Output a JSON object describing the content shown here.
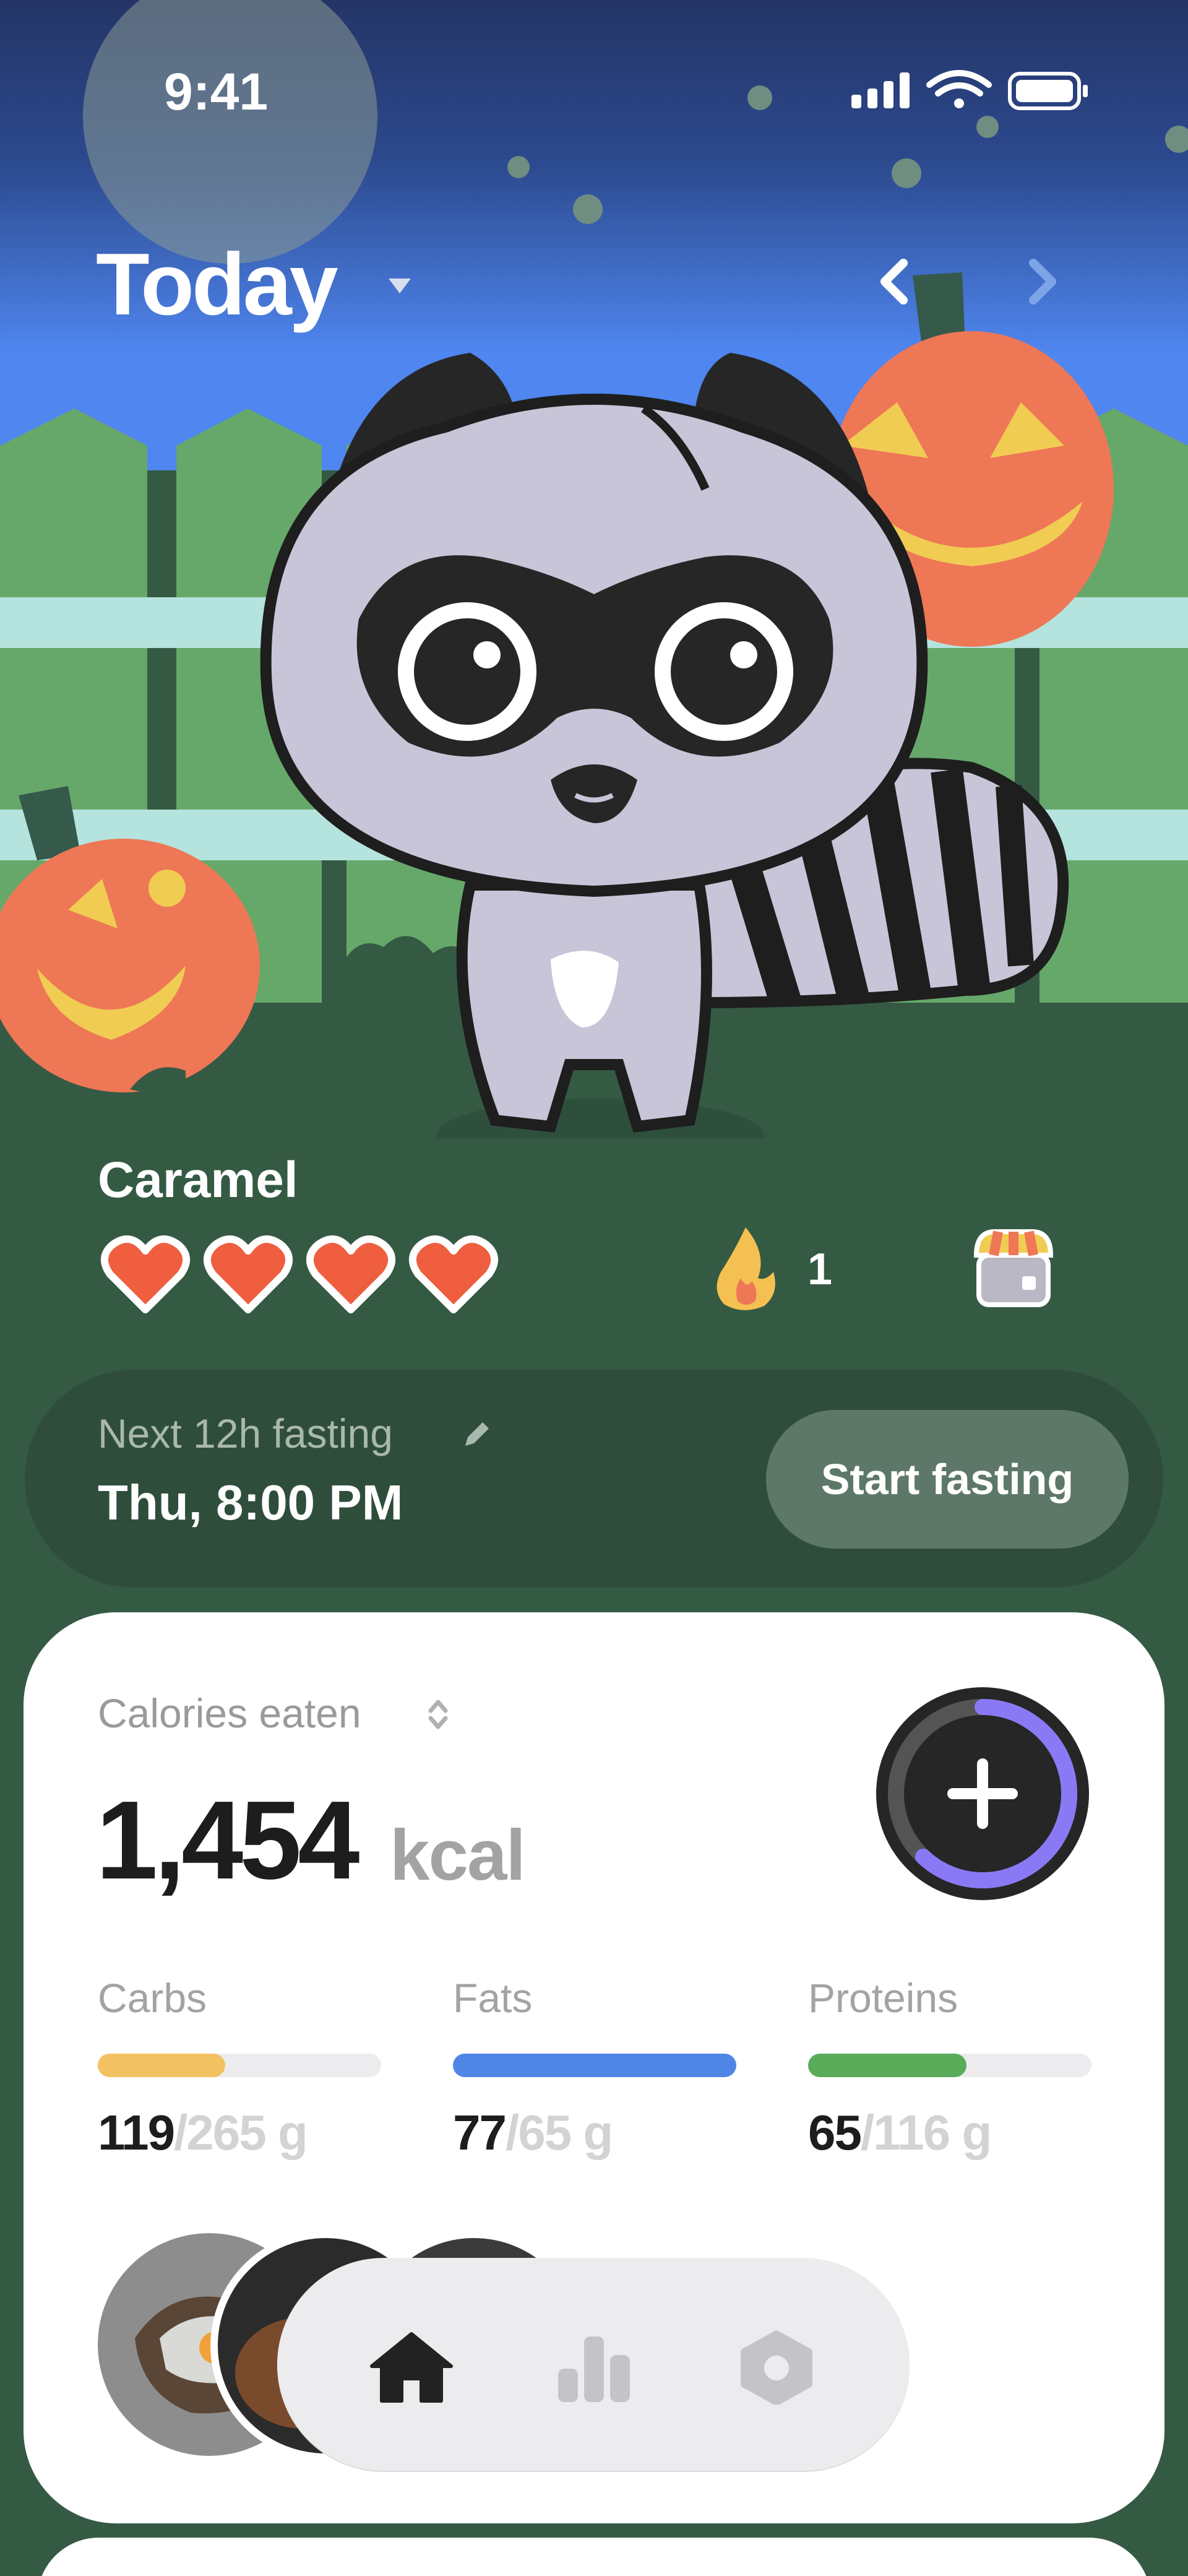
{
  "status_bar": {
    "time": "9:41"
  },
  "header": {
    "title": "Today"
  },
  "pet": {
    "name": "Caramel",
    "hearts": 4,
    "streak": "1"
  },
  "fasting": {
    "label": "Next 12h fasting",
    "time": "Thu, 8:00 PM",
    "button": "Start fasting"
  },
  "calories": {
    "label": "Calories eaten",
    "value": "1,454",
    "unit": "kcal",
    "ring_progress": 0.62
  },
  "macros": [
    {
      "name": "Carbs",
      "eaten": "119",
      "target": "/265 g",
      "progress": 0.45,
      "color": "#f2c161"
    },
    {
      "name": "Fats",
      "eaten": "77",
      "target": "/65 g",
      "progress": 1.0,
      "color": "#4f86e6"
    },
    {
      "name": "Proteins",
      "eaten": "65",
      "target": "/116 g",
      "progress": 0.56,
      "color": "#5aab5a"
    }
  ],
  "colors": {
    "accent_ring": "#8a79f5",
    "grass": "#355a43",
    "sky_top": "#243466",
    "sky_bottom": "#4f86ef"
  },
  "tabbar": {
    "items": [
      "home-icon",
      "chart-icon",
      "settings-icon"
    ],
    "active": "home-icon"
  }
}
